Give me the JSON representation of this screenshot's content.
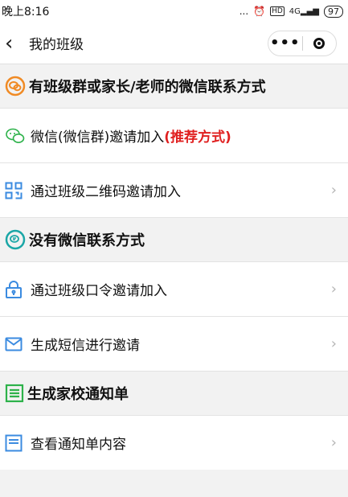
{
  "status": {
    "time": "晚上8:16",
    "dots": "...",
    "net": "4G",
    "battery": "97"
  },
  "nav": {
    "title": "我的班级",
    "more": "•••"
  },
  "sections": [
    {
      "title": "有班级群或家长/老师的微信联系方式",
      "icon": "wechat-contact-icon"
    },
    {
      "title": "没有微信联系方式",
      "icon": "no-wechat-icon"
    },
    {
      "title": "生成家校通知单",
      "icon": "notice-list-icon"
    }
  ],
  "rows": {
    "wechat_invite": {
      "label": "微信(微信群)邀请加入",
      "tag": "(推荐方式)"
    },
    "qr_invite": {
      "label": "通过班级二维码邀请加入",
      "chevron": "›"
    },
    "code_invite": {
      "label": "通过班级口令邀请加入",
      "chevron": "›"
    },
    "sms_invite": {
      "label": "生成短信进行邀请",
      "chevron": "›"
    },
    "view_notice": {
      "label": "查看通知单内容",
      "chevron": "›"
    }
  },
  "colors": {
    "accent_orange": "#f08a24",
    "accent_teal": "#1aa6a6",
    "accent_green": "#2db24a",
    "accent_blue": "#3b8be0",
    "highlight": "#e02020"
  }
}
